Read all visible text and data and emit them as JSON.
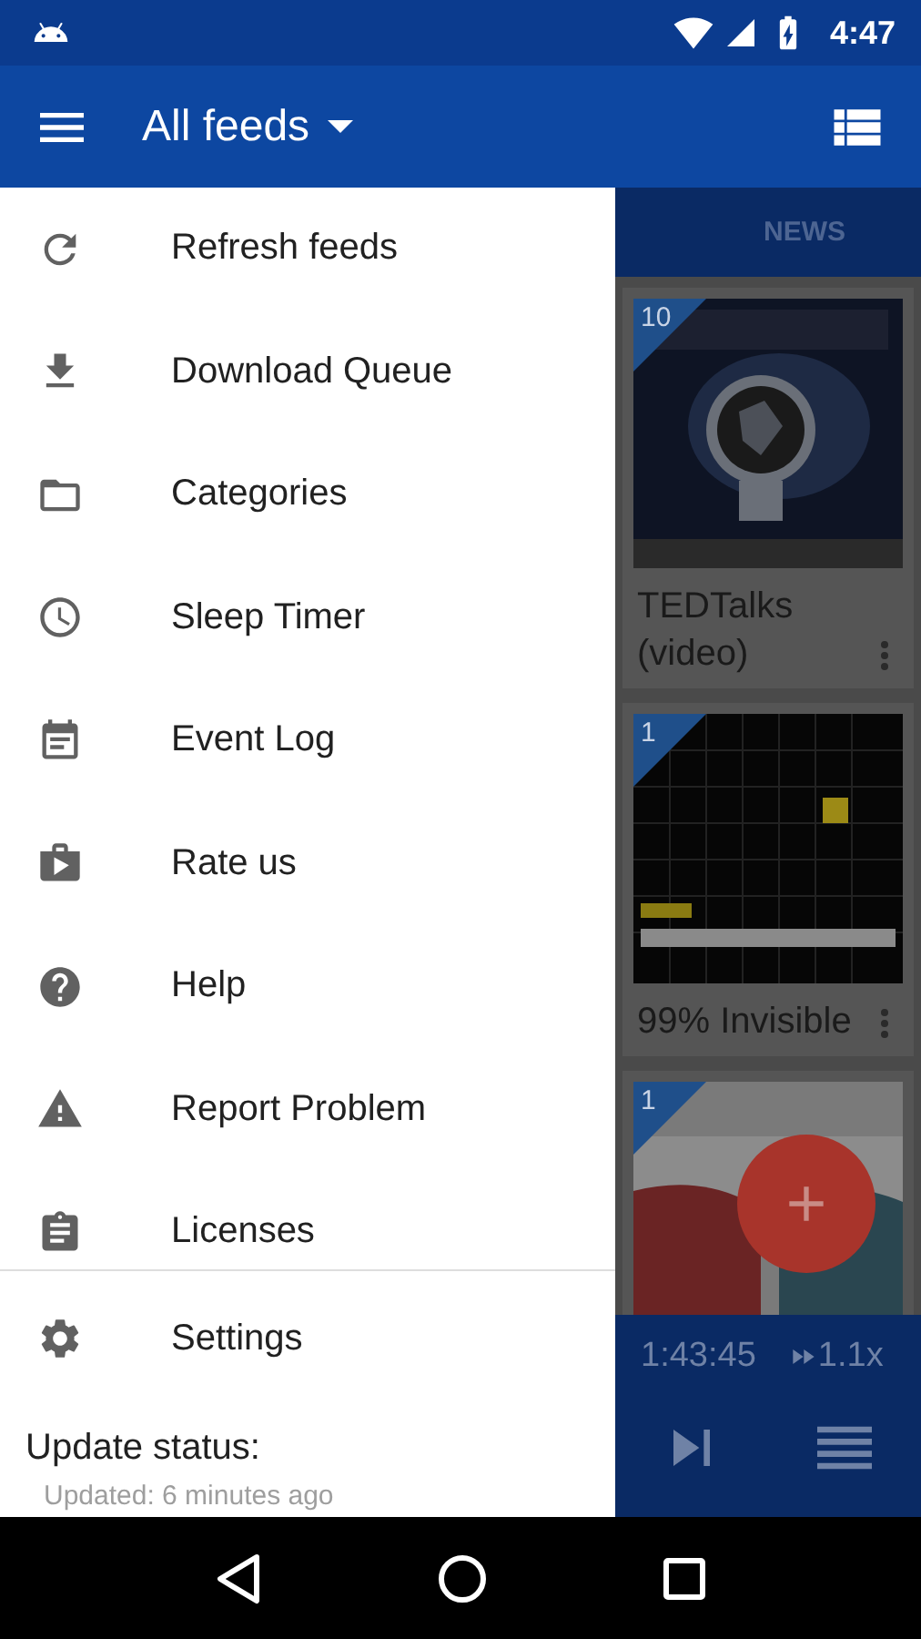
{
  "status_bar": {
    "time": "4:47"
  },
  "app_bar": {
    "title": "All feeds"
  },
  "drawer": {
    "items": [
      {
        "label": "Refresh feeds"
      },
      {
        "label": "Download Queue"
      },
      {
        "label": "Categories"
      },
      {
        "label": "Sleep Timer"
      },
      {
        "label": "Event Log"
      },
      {
        "label": "Rate us"
      },
      {
        "label": "Help"
      },
      {
        "label": "Report Problem"
      },
      {
        "label": "Licenses"
      }
    ],
    "settings": {
      "label": "Settings"
    },
    "update_status": {
      "title": "Update status:",
      "detail": "Updated: 6 minutes ago"
    }
  },
  "content": {
    "tab": {
      "label": "NEWS"
    },
    "cards": [
      {
        "badge": "10",
        "title": "TEDTalks (video)"
      },
      {
        "badge": "1",
        "title": "99% Invisible"
      },
      {
        "badge": "1"
      }
    ],
    "player": {
      "elapsed": "1:43:45",
      "speed": "1.1x"
    }
  }
}
